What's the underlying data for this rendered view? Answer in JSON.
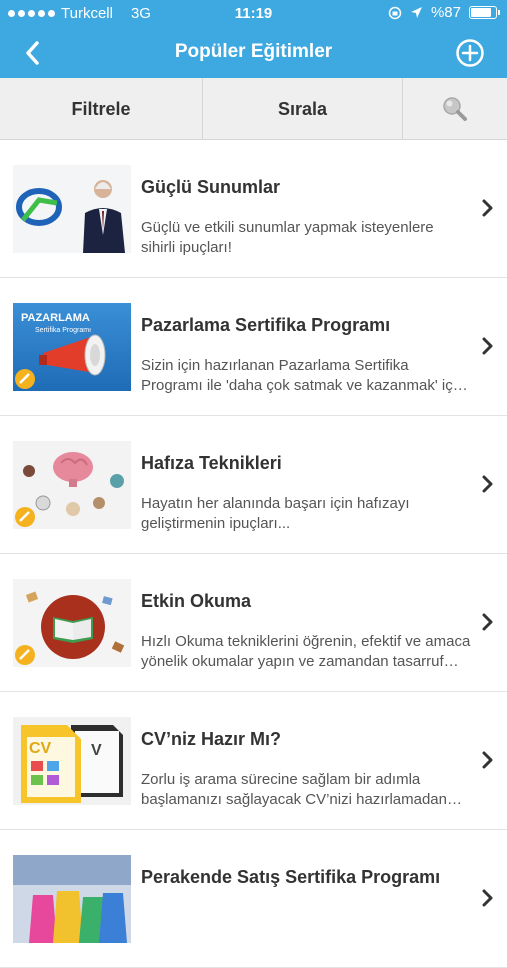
{
  "status": {
    "carrier": "Turkcell",
    "network": "3G",
    "time": "11:19",
    "battery": "%87"
  },
  "nav": {
    "title": "Popüler Eğitimler",
    "back_icon": "chevron-left-icon",
    "add_icon": "plus-circle-icon"
  },
  "toolbar": {
    "filter_label": "Filtrele",
    "sort_label": "Sırala",
    "search_icon": "search-icon"
  },
  "colors": {
    "brand": "#3ea8e0",
    "toolbar_bg": "#efefef"
  },
  "courses": [
    {
      "title": "Güçlü Sunumlar",
      "desc": "Güçlü ve etkili sunumlar yapmak isteyenlere sihirli ipuçları!"
    },
    {
      "title": "Pazarlama Sertifika Programı",
      "desc": "Sizin için hazırlanan Pazarlama Sertifika Programı ile 'daha çok satmak ve kazanmak' için gereken her şey",
      "thumb_text_1": "PAZARLAMA",
      "thumb_text_2": "Sertifika Programı"
    },
    {
      "title": "Hafıza Teknikleri",
      "desc": "Hayatın her alanında başarı için hafızayı geliştirmenin ipuçları..."
    },
    {
      "title": "Etkin Okuma",
      "desc": "Hızlı Okuma tekniklerini öğrenin, efektif ve amaca yönelik okumalar yapın ve zamandan tasarruf edin"
    },
    {
      "title": "CV’niz Hazır Mı?",
      "desc": "Zorlu iş arama sürecine sağlam bir adımla başlamanızı sağlayacak CV’nizi hazırlamadan önce",
      "thumb_text_1": "CV"
    },
    {
      "title": "Perakende Satış Sertifika Programı",
      "desc": ""
    }
  ]
}
